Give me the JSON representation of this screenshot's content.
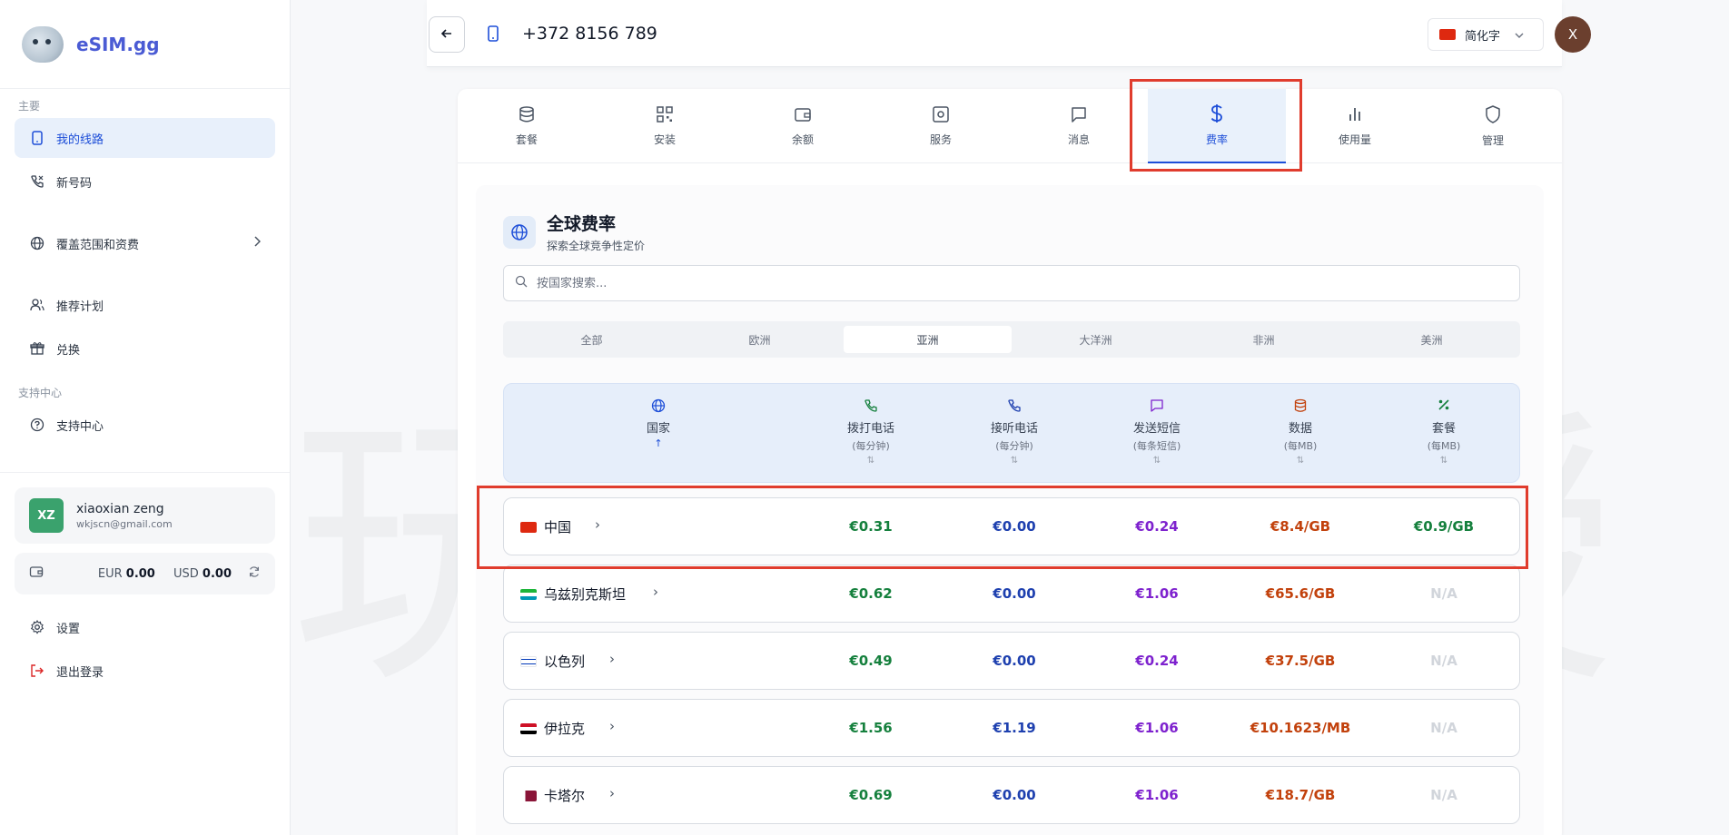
{
  "app": {
    "brand": "eSIM.gg"
  },
  "sidebar": {
    "section_main": "主要",
    "items_main": [
      {
        "label": "我的线路",
        "icon": "phone-icon",
        "active": true
      },
      {
        "label": "新号码",
        "icon": "phone-call-icon"
      },
      {
        "label": "覆盖范围和资费",
        "icon": "globe-icon"
      },
      {
        "label": "推荐计划",
        "icon": "users-icon"
      },
      {
        "label": "兑换",
        "icon": "gift-icon"
      }
    ],
    "section_support": "支持中心",
    "support_item": {
      "label": "支持中心",
      "icon": "help-circle-icon"
    },
    "user": {
      "initials": "XZ",
      "name": "xiaoxian zeng",
      "email": "wkjscn@gmail.com"
    },
    "balance": {
      "eur_label": "EUR",
      "eur_value": "0.00",
      "usd_label": "USD",
      "usd_value": "0.00"
    },
    "settings_label": "设置",
    "logout_label": "退出登录"
  },
  "topbar": {
    "phone_number": "+372 8156 789",
    "language": "简化字",
    "avatar_initial": "X"
  },
  "tabs": [
    {
      "label": "套餐",
      "icon": "database-icon"
    },
    {
      "label": "安装",
      "icon": "qr-code-icon"
    },
    {
      "label": "余额",
      "icon": "wallet-icon"
    },
    {
      "label": "服务",
      "icon": "settings-box-icon"
    },
    {
      "label": "消息",
      "icon": "message-icon"
    },
    {
      "label": "费率",
      "icon": "dollar-icon",
      "active": true
    },
    {
      "label": "使用量",
      "icon": "bar-chart-icon"
    },
    {
      "label": "管理",
      "icon": "shield-icon"
    }
  ],
  "rates": {
    "title": "全球费率",
    "subtitle": "探索全球竞争性定价",
    "search_placeholder": "按国家搜索...",
    "regions": [
      "全部",
      "欧洲",
      "亚洲",
      "大洋洲",
      "非洲",
      "美洲"
    ],
    "active_region": "亚洲",
    "columns": {
      "country": {
        "label": "国家",
        "sort": "↑"
      },
      "call_out": {
        "label": "拨打电话",
        "unit": "(每分钟)",
        "sort": "⇅"
      },
      "call_in": {
        "label": "接听电话",
        "unit": "(每分钟)",
        "sort": "⇅"
      },
      "sms": {
        "label": "发送短信",
        "unit": "(每条短信)",
        "sort": "⇅"
      },
      "data": {
        "label": "数据",
        "unit": "(每MB)",
        "sort": "⇅"
      },
      "plan": {
        "label": "套餐",
        "unit": "(每MB)",
        "sort": "⇅"
      }
    },
    "rows": [
      {
        "country": "中国",
        "flag_colors": [
          "#de2910",
          "#de2910"
        ],
        "call_out": "€0.31",
        "call_in": "€0.00",
        "sms": "€0.24",
        "data": "€8.4/GB",
        "plan": "€0.9/GB"
      },
      {
        "country": "乌兹别克斯坦",
        "flag_colors": [
          "#1eb53a",
          "#0099b5"
        ],
        "call_out": "€0.62",
        "call_in": "€0.00",
        "sms": "€1.06",
        "data": "€65.6/GB",
        "plan": "N/A"
      },
      {
        "country": "以色列",
        "flag_colors": [
          "#ffffff",
          "#0038b8"
        ],
        "call_out": "€0.49",
        "call_in": "€0.00",
        "sms": "€0.24",
        "data": "€37.5/GB",
        "plan": "N/A"
      },
      {
        "country": "伊拉克",
        "flag_colors": [
          "#ce1126",
          "#000000"
        ],
        "call_out": "€1.56",
        "call_in": "€1.19",
        "sms": "€1.06",
        "data": "€10.1623/MB",
        "plan": "N/A"
      },
      {
        "country": "卡塔尔",
        "flag_colors": [
          "#8a1538",
          "#ffffff"
        ],
        "call_out": "€0.69",
        "call_in": "€0.00",
        "sms": "€1.06",
        "data": "€18.7/GB",
        "plan": "N/A"
      }
    ]
  },
  "watermark": "玩卡教授"
}
